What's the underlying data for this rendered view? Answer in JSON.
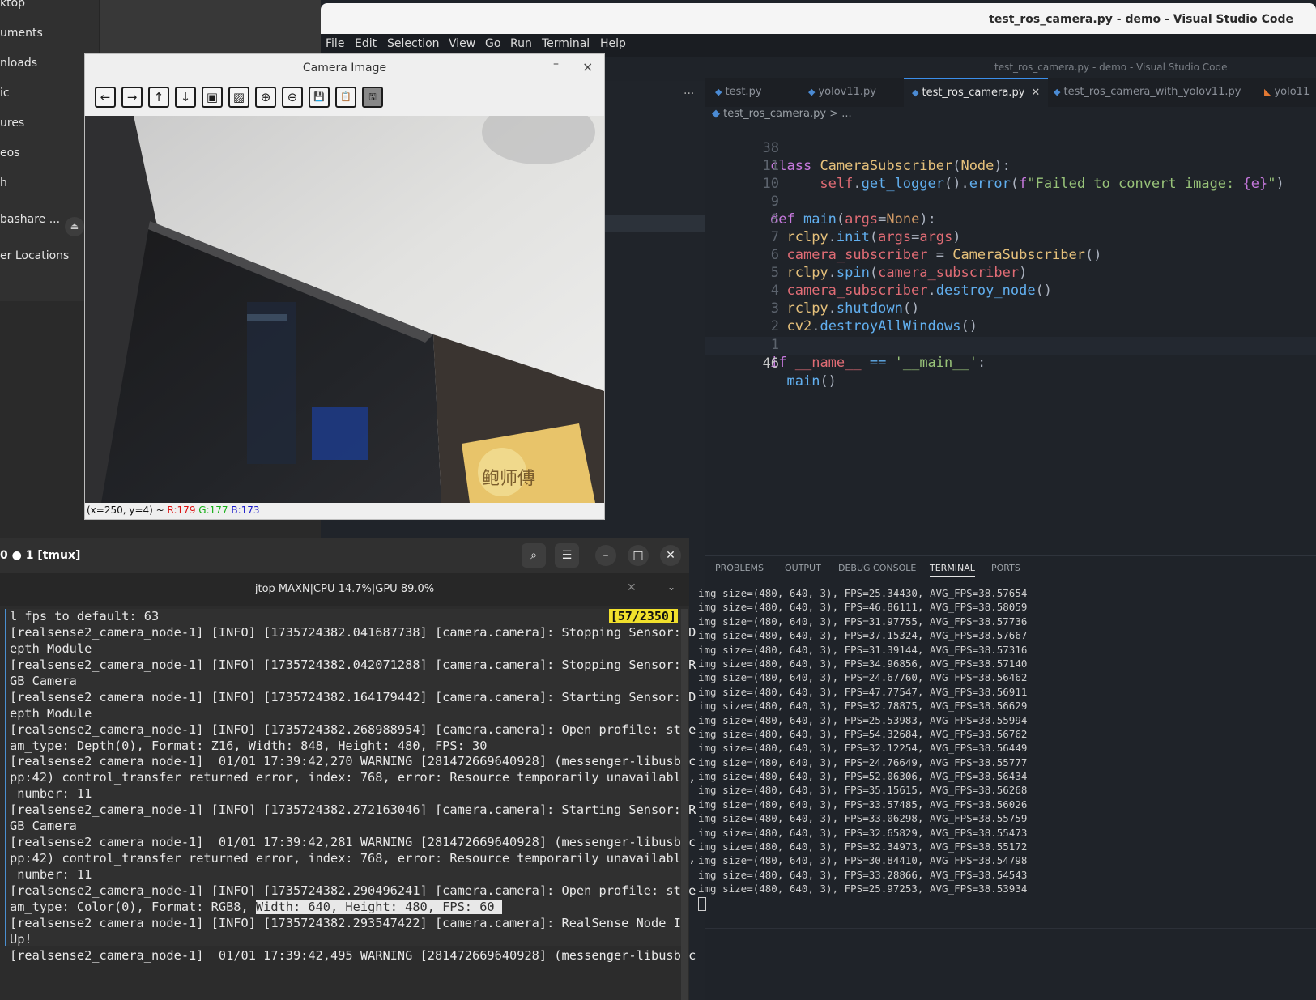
{
  "file_manager": {
    "items": [
      "ktop",
      "uments",
      "nloads",
      "ic",
      "ures",
      "eos",
      "h",
      "bashare ...",
      "er Locations"
    ]
  },
  "vscode": {
    "window_title": "test_ros_camera.py - demo - Visual Studio Code",
    "menu": [
      "File",
      "Edit",
      "Selection",
      "View",
      "Go",
      "Run",
      "Terminal",
      "Help"
    ],
    "subtitle": "test_ros_camera.py - demo - Visual Studio Code",
    "more": "...",
    "tabs": [
      {
        "label": "test.py",
        "active": false
      },
      {
        "label": "yolov11.py",
        "active": false
      },
      {
        "label": "test_ros_camera.py",
        "active": true
      },
      {
        "label": "test_ros_camera_with_yolov11.py",
        "active": false
      },
      {
        "label": "yolo11",
        "active": false
      }
    ],
    "breadcrumb": "test_ros_camera.py > ...",
    "code_lines": [
      {
        "num": "38",
        "text": "class CameraSubscriber(Node):"
      },
      {
        "num": "11",
        "text": "        self.get_logger().error(f\"Failed to convert image: {e}\")"
      },
      {
        "num": "10",
        "text": ""
      },
      {
        "num": "9",
        "text": "def main(args=None):"
      },
      {
        "num": "8",
        "text": "  rclpy.init(args=args)"
      },
      {
        "num": "7",
        "text": "  camera_subscriber = CameraSubscriber()"
      },
      {
        "num": "6",
        "text": "  rclpy.spin(camera_subscriber)"
      },
      {
        "num": "5",
        "text": "  camera_subscriber.destroy_node()"
      },
      {
        "num": "4",
        "text": "  rclpy.shutdown()"
      },
      {
        "num": "3",
        "text": "  cv2.destroyAllWindows()"
      },
      {
        "num": "2",
        "text": ""
      },
      {
        "num": "1",
        "text": "if __name__ == '__main__':"
      },
      {
        "num": "46",
        "text": "  main()"
      }
    ],
    "panel_tabs": [
      "PROBLEMS",
      "OUTPUT",
      "DEBUG CONSOLE",
      "TERMINAL",
      "PORTS"
    ],
    "terminal_lines": [
      "img size=(480, 640, 3), FPS=25.34430, AVG_FPS=38.57654",
      "img size=(480, 640, 3), FPS=46.86111, AVG_FPS=38.58059",
      "img size=(480, 640, 3), FPS=31.97755, AVG_FPS=38.57736",
      "img size=(480, 640, 3), FPS=37.15324, AVG_FPS=38.57667",
      "img size=(480, 640, 3), FPS=31.39144, AVG_FPS=38.57316",
      "img size=(480, 640, 3), FPS=34.96856, AVG_FPS=38.57140",
      "img size=(480, 640, 3), FPS=24.67760, AVG_FPS=38.56462",
      "img size=(480, 640, 3), FPS=47.77547, AVG_FPS=38.56911",
      "img size=(480, 640, 3), FPS=32.78875, AVG_FPS=38.56629",
      "img size=(480, 640, 3), FPS=25.53983, AVG_FPS=38.55994",
      "img size=(480, 640, 3), FPS=54.32684, AVG_FPS=38.56762",
      "img size=(480, 640, 3), FPS=32.12254, AVG_FPS=38.56449",
      "img size=(480, 640, 3), FPS=24.76649, AVG_FPS=38.55777",
      "img size=(480, 640, 3), FPS=52.06306, AVG_FPS=38.56434",
      "img size=(480, 640, 3), FPS=35.15615, AVG_FPS=38.56268",
      "img size=(480, 640, 3), FPS=33.57485, AVG_FPS=38.56026",
      "img size=(480, 640, 3), FPS=33.06298, AVG_FPS=38.55759",
      "img size=(480, 640, 3), FPS=32.65829, AVG_FPS=38.55473",
      "img size=(480, 640, 3), FPS=32.34973, AVG_FPS=38.55172",
      "img size=(480, 640, 3), FPS=30.84410, AVG_FPS=38.54798",
      "img size=(480, 640, 3), FPS=33.28866, AVG_FPS=38.54543",
      "img size=(480, 640, 3), FPS=25.97253, AVG_FPS=38.53934"
    ]
  },
  "camera_window": {
    "title": "Camera Image",
    "minimize": "–",
    "close": "×",
    "toolbar": [
      "←",
      "→",
      "↑",
      "↓",
      "▣",
      "▨",
      "⊕",
      "⊖",
      "💾",
      "📋",
      "🖫"
    ],
    "status_prefix": "(x=250, y=4) ~ ",
    "status_r": "R:179",
    "status_g": "G:177",
    "status_b": "B:173",
    "monitor_text": "鲍师傅"
  },
  "terminal_window": {
    "title": "0 ● 1 [tmux]",
    "tab_title": "jtop MAXN|CPU 14.7%|GPU 89.0%",
    "scroll_counter": "[57/2350]",
    "lines": [
      "l_fps to default: 63",
      "[realsense2_camera_node-1] [INFO] [1735724382.041687738] [camera.camera]: Stopping Sensor: D",
      "epth Module",
      "[realsense2_camera_node-1] [INFO] [1735724382.042071288] [camera.camera]: Stopping Sensor: R",
      "GB Camera",
      "[realsense2_camera_node-1] [INFO] [1735724382.164179442] [camera.camera]: Starting Sensor: D",
      "epth Module",
      "[realsense2_camera_node-1] [INFO] [1735724382.268988954] [camera.camera]: Open profile: stre",
      "am_type: Depth(0), Format: Z16, Width: 848, Height: 480, FPS: 30",
      "[realsense2_camera_node-1]  01/01 17:39:42,270 WARNING [281472669640928] (messenger-libusb.c",
      "pp:42) control_transfer returned error, index: 768, error: Resource temporarily unavailable,",
      " number: 11",
      "[realsense2_camera_node-1] [INFO] [1735724382.272163046] [camera.camera]: Starting Sensor: R",
      "GB Camera",
      "[realsense2_camera_node-1]  01/01 17:39:42,281 WARNING [281472669640928] (messenger-libusb.c",
      "pp:42) control_transfer returned error, index: 768, error: Resource temporarily unavailable,",
      " number: 11",
      "[realsense2_camera_node-1] [INFO] [1735724382.290496241] [camera.camera]: Open profile: stre",
      "am_type: Color(0), Format: RGB8, ",
      "[realsense2_camera_node-1] [INFO] [1735724382.293547422] [camera.camera]: RealSense Node Is",
      "Up!",
      "[realsense2_camera_node-1]  01/01 17:39:42,495 WARNING [281472669640928] (messenger-libusb.c"
    ],
    "highlighted": "Width: 640, Height: 480, FPS: 60 "
  }
}
